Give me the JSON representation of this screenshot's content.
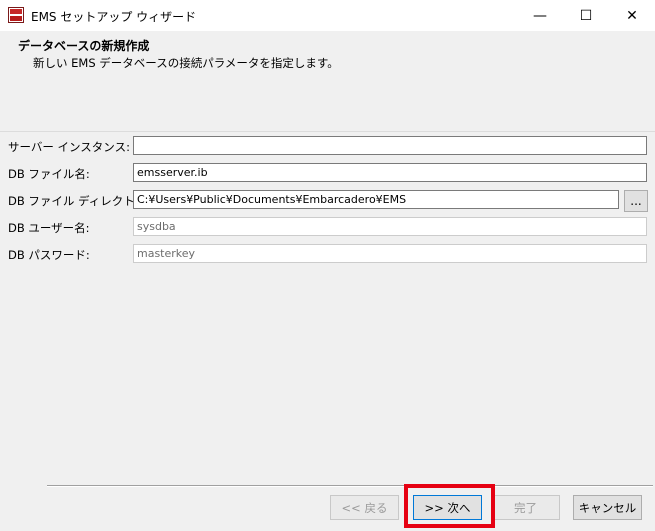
{
  "window": {
    "title": "EMS セットアップ ウィザード",
    "minimize_glyph": "—",
    "maximize_glyph": "☐",
    "close_glyph": "✕",
    "icon": "ems-app-icon"
  },
  "header": {
    "title": "データベースの新規作成",
    "description": "新しい EMS データベースの接続パラメータを指定します。"
  },
  "form": {
    "server_instance": {
      "label": "サーバー インスタンス:",
      "value": ""
    },
    "db_file_name": {
      "label": "DB ファイル名:",
      "value": "emsserver.ib"
    },
    "db_file_dir": {
      "label": "DB ファイル ディレクトリ:",
      "value": "C:¥Users¥Public¥Documents¥Embarcadero¥EMS",
      "browse_label": "..."
    },
    "db_user": {
      "label": "DB ユーザー名:",
      "value": "sysdba"
    },
    "db_password": {
      "label": "DB パスワード:",
      "value": "masterkey"
    }
  },
  "buttons": {
    "back": "<< 戻る",
    "next": ">> 次へ",
    "finish": "完了",
    "cancel": "キャンセル"
  },
  "colors": {
    "highlight": "#e60012",
    "background": "#f0f0f0"
  }
}
